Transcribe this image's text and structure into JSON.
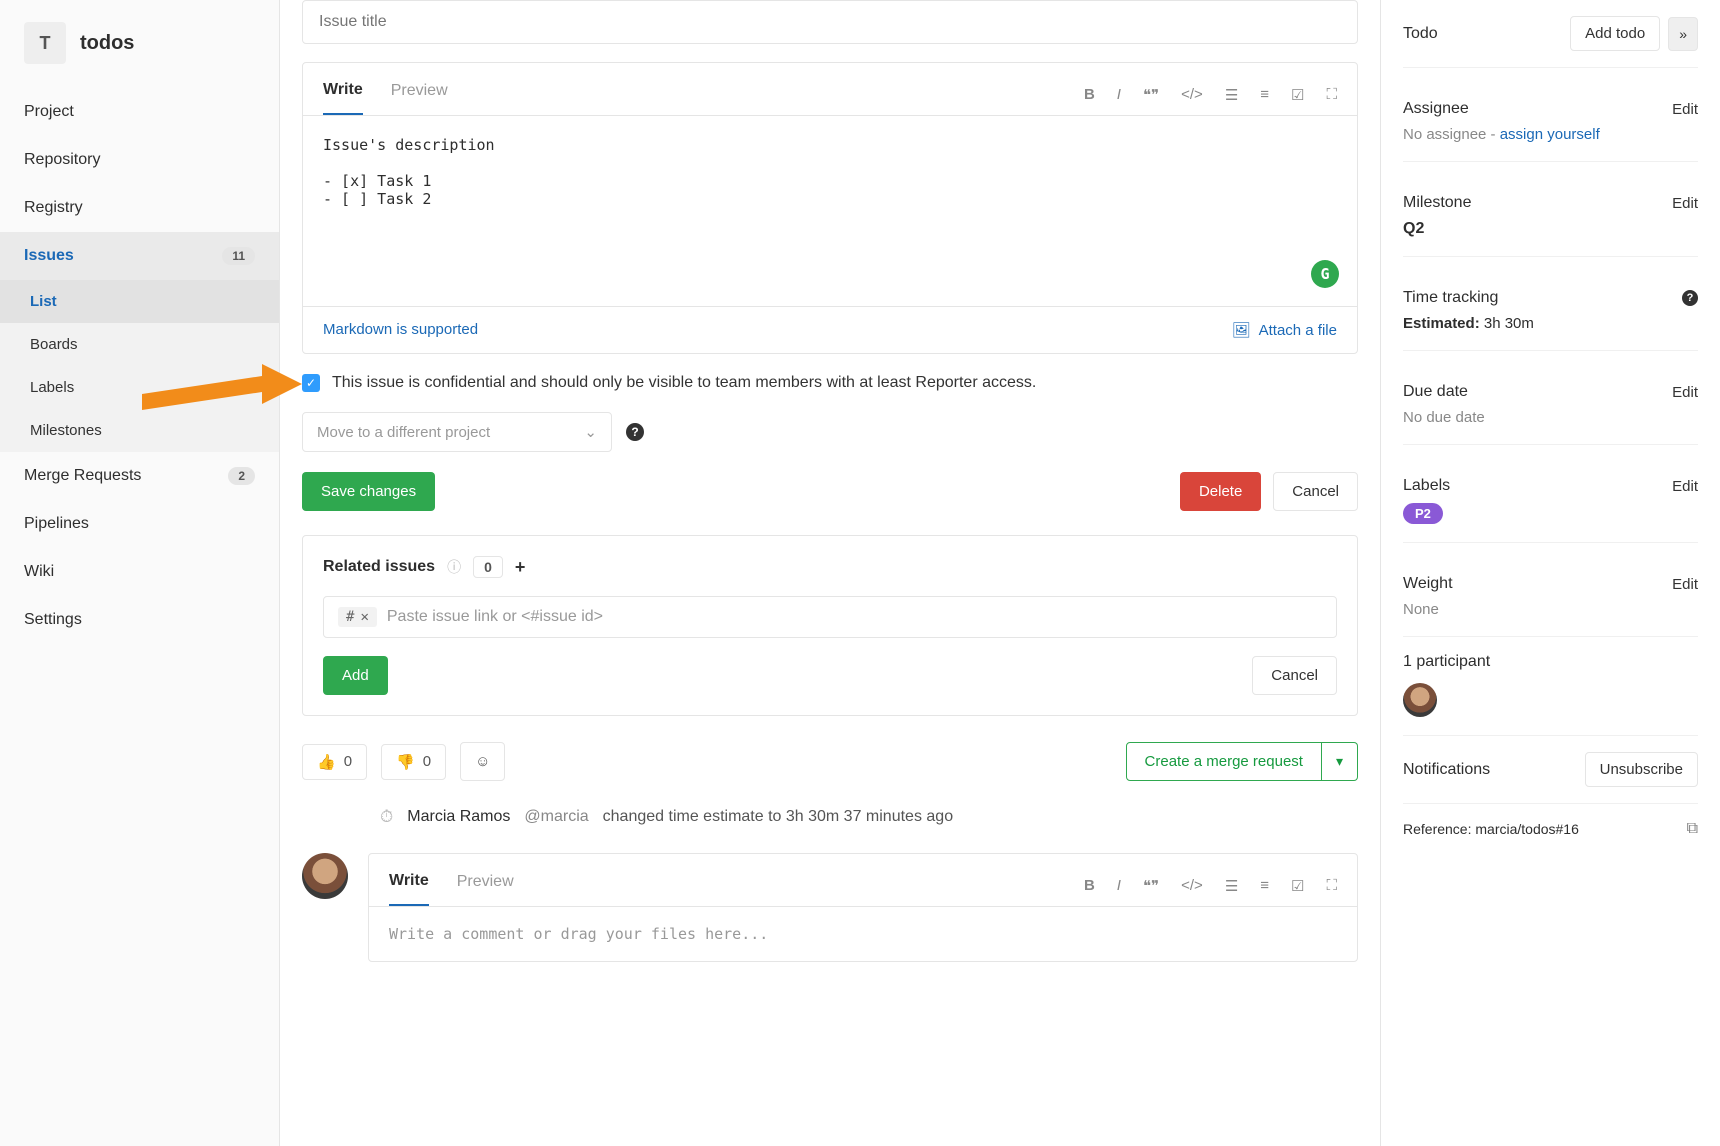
{
  "project": {
    "letter": "T",
    "name": "todos"
  },
  "sidebar": {
    "items": [
      {
        "label": "Project"
      },
      {
        "label": "Repository"
      },
      {
        "label": "Registry"
      },
      {
        "label": "Issues",
        "count": "11",
        "active": true
      },
      {
        "label": "Merge Requests",
        "count": "2"
      },
      {
        "label": "Pipelines"
      },
      {
        "label": "Wiki"
      },
      {
        "label": "Settings"
      }
    ],
    "issues_sub": [
      {
        "label": "List",
        "active": true
      },
      {
        "label": "Boards"
      },
      {
        "label": "Labels"
      },
      {
        "label": "Milestones"
      }
    ]
  },
  "issue": {
    "title_placeholder": "Issue title",
    "write_tab": "Write",
    "preview_tab": "Preview",
    "body": "Issue's description\n\n- [x] Task 1\n- [ ] Task 2",
    "markdown_link": "Markdown is supported",
    "attach_link": "Attach a file",
    "confidential_text": "This issue is confidential and should only be visible to team members with at least Reporter access.",
    "move_placeholder": "Move to a different project",
    "save_btn": "Save changes",
    "delete_btn": "Delete",
    "cancel_btn": "Cancel"
  },
  "related": {
    "title": "Related issues",
    "count": "0",
    "input_hash": "#",
    "input_placeholder": "Paste issue link or <#issue id>",
    "add_btn": "Add",
    "cancel_btn": "Cancel"
  },
  "reactions": {
    "thumbs_up": "0",
    "thumbs_down": "0",
    "mr_btn": "Create a merge request"
  },
  "activity": {
    "name": "Marcia Ramos",
    "handle": "@marcia",
    "text": "changed time estimate to 3h 30m 37 minutes ago"
  },
  "comment": {
    "write_tab": "Write",
    "preview_tab": "Preview",
    "placeholder": "Write a comment or drag your files here..."
  },
  "right": {
    "todo": "Todo",
    "add_todo": "Add todo",
    "assignee": "Assignee",
    "no_assignee": "No assignee - ",
    "assign_yourself": "assign yourself",
    "milestone": "Milestone",
    "milestone_val": "Q2",
    "time_tracking": "Time tracking",
    "estimated_label": "Estimated:",
    "estimated_val": "3h 30m",
    "due_date": "Due date",
    "no_due_date": "No due date",
    "labels": "Labels",
    "label_val": "P2",
    "weight": "Weight",
    "weight_val": "None",
    "participants": "1 participant",
    "notifications": "Notifications",
    "unsubscribe": "Unsubscribe",
    "reference_label": "Reference: ",
    "reference_val": "marcia/todos#16",
    "edit": "Edit"
  }
}
